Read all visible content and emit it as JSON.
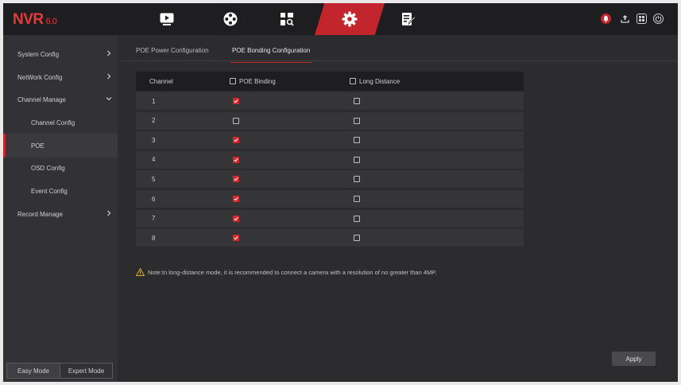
{
  "brand": {
    "name": "NVR",
    "version": "6.0",
    "accent": "#c2262c"
  },
  "topnav": [
    {
      "icon": "playback-icon",
      "active": false
    },
    {
      "icon": "film-reel-icon",
      "active": false
    },
    {
      "icon": "search-file-icon",
      "active": false
    },
    {
      "icon": "gear-icon",
      "active": true
    },
    {
      "icon": "edit-list-icon",
      "active": false
    }
  ],
  "topright_icons": [
    "alarm-bell-icon",
    "upload-icon",
    "grid-icon",
    "power-icon"
  ],
  "sidebar": {
    "items": [
      {
        "label": "System Config",
        "chevron": "right"
      },
      {
        "label": "NetWork Config",
        "chevron": "right"
      },
      {
        "label": "Channel Manage",
        "chevron": "down"
      },
      {
        "label": "Channel Config"
      },
      {
        "label": "POE",
        "active": true
      },
      {
        "label": "OSD Config"
      },
      {
        "label": "Event Config"
      },
      {
        "label": "Record Manage",
        "chevron": "right"
      }
    ],
    "modes": [
      {
        "label": "Easy Mode",
        "active": true
      },
      {
        "label": "Expert Mode",
        "active": false
      }
    ]
  },
  "tabs": [
    {
      "label": "POE Power Configuration",
      "active": false
    },
    {
      "label": "POE Bonding Configuration",
      "active": true
    }
  ],
  "table": {
    "headers": {
      "channel": "Channel",
      "poe_binding": "POE Binding",
      "long_distance": "Long Distance"
    },
    "rows": [
      {
        "channel": "1",
        "poe_binding": true,
        "long_distance": false
      },
      {
        "channel": "2",
        "poe_binding": false,
        "long_distance": false
      },
      {
        "channel": "3",
        "poe_binding": true,
        "long_distance": false
      },
      {
        "channel": "4",
        "poe_binding": true,
        "long_distance": false
      },
      {
        "channel": "5",
        "poe_binding": true,
        "long_distance": false
      },
      {
        "channel": "6",
        "poe_binding": true,
        "long_distance": false
      },
      {
        "channel": "7",
        "poe_binding": true,
        "long_distance": false
      },
      {
        "channel": "8",
        "poe_binding": true,
        "long_distance": false
      }
    ]
  },
  "note": "Note:In long-distance mode, it is recommended to connect a camera with a resolution of no greater than 4MP.",
  "apply_label": "Apply"
}
